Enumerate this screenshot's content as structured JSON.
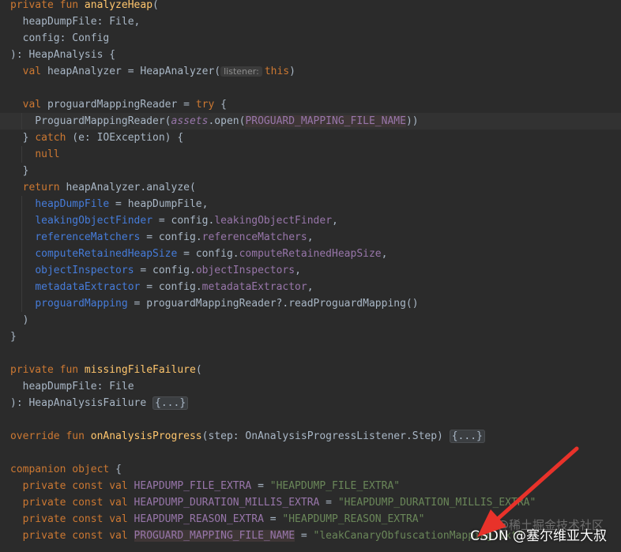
{
  "editor": {
    "lines": [
      [
        [
          "kw",
          "private fun "
        ],
        [
          "fn",
          "analyzeHeap"
        ],
        [
          "p",
          "("
        ]
      ],
      [
        [
          "p",
          "  heapDumpFile: File,"
        ]
      ],
      [
        [
          "p",
          "  config: Config"
        ]
      ],
      [
        [
          "p",
          "): HeapAnalysis {"
        ]
      ],
      [
        [
          "p",
          "  "
        ],
        [
          "kw",
          "val "
        ],
        [
          "p",
          "heapAnalyzer = HeapAnalyzer("
        ],
        [
          "hint",
          "listener:"
        ],
        [
          "kw",
          "this"
        ],
        [
          "p",
          ")"
        ]
      ],
      [],
      [
        [
          "p",
          "  "
        ],
        [
          "kw",
          "val "
        ],
        [
          "p",
          "proguardMappingReader = "
        ],
        [
          "kw",
          "try "
        ],
        [
          "p",
          "{"
        ]
      ],
      [
        [
          "p",
          "    ProguardMappingReader("
        ],
        [
          "prop-i",
          "assets"
        ],
        [
          "p",
          ".open("
        ],
        [
          "const",
          "PROGUARD_MAPPING_FILE_NAME"
        ],
        [
          "p",
          "))"
        ]
      ],
      [
        [
          "p",
          "  } "
        ],
        [
          "kw",
          "catch "
        ],
        [
          "p",
          "(e: IOException) {"
        ]
      ],
      [
        [
          "p",
          "    "
        ],
        [
          "kw",
          "null"
        ]
      ],
      [
        [
          "p",
          "  }"
        ]
      ],
      [
        [
          "p",
          "  "
        ],
        [
          "kw",
          "return "
        ],
        [
          "p",
          "heapAnalyzer.analyze("
        ]
      ],
      [
        [
          "p",
          "    "
        ],
        [
          "named",
          "heapDumpFile"
        ],
        [
          "p",
          " = heapDumpFile,"
        ]
      ],
      [
        [
          "p",
          "    "
        ],
        [
          "named",
          "leakingObjectFinder"
        ],
        [
          "p",
          " = config."
        ],
        [
          "prop",
          "leakingObjectFinder"
        ],
        [
          "p",
          ","
        ]
      ],
      [
        [
          "p",
          "    "
        ],
        [
          "named",
          "referenceMatchers"
        ],
        [
          "p",
          " = config."
        ],
        [
          "prop",
          "referenceMatchers"
        ],
        [
          "p",
          ","
        ]
      ],
      [
        [
          "p",
          "    "
        ],
        [
          "named",
          "computeRetainedHeapSize"
        ],
        [
          "p",
          " = config."
        ],
        [
          "prop",
          "computeRetainedHeapSize"
        ],
        [
          "p",
          ","
        ]
      ],
      [
        [
          "p",
          "    "
        ],
        [
          "named",
          "objectInspectors"
        ],
        [
          "p",
          " = config."
        ],
        [
          "prop",
          "objectInspectors"
        ],
        [
          "p",
          ","
        ]
      ],
      [
        [
          "p",
          "    "
        ],
        [
          "named",
          "metadataExtractor"
        ],
        [
          "p",
          " = config."
        ],
        [
          "prop",
          "metadataExtractor"
        ],
        [
          "p",
          ","
        ]
      ],
      [
        [
          "p",
          "    "
        ],
        [
          "named",
          "proguardMapping"
        ],
        [
          "p",
          " = proguardMappingReader?.readProguardMapping()"
        ]
      ],
      [
        [
          "p",
          "  )"
        ]
      ],
      [
        [
          "p",
          "}"
        ]
      ],
      [],
      [
        [
          "kw",
          "private fun "
        ],
        [
          "fn",
          "missingFileFailure"
        ],
        [
          "p",
          "("
        ]
      ],
      [
        [
          "p",
          "  heapDumpFile: File"
        ]
      ],
      [
        [
          "p",
          "): HeapAnalysisFailure "
        ],
        [
          "fold",
          "{...}"
        ]
      ],
      [],
      [
        [
          "kw",
          "override fun "
        ],
        [
          "fn",
          "onAnalysisProgress"
        ],
        [
          "p",
          "(step: OnAnalysisProgressListener.Step) "
        ],
        [
          "fold",
          "{...}"
        ]
      ],
      [],
      [
        [
          "kw",
          "companion object "
        ],
        [
          "p",
          "{"
        ]
      ],
      [
        [
          "p",
          "  "
        ],
        [
          "kw",
          "private const val "
        ],
        [
          "prop",
          "HEAPDUMP_FILE_EXTRA"
        ],
        [
          "p",
          " = "
        ],
        [
          "str",
          "\"HEAPDUMP_FILE_EXTRA\""
        ]
      ],
      [
        [
          "p",
          "  "
        ],
        [
          "kw",
          "private const val "
        ],
        [
          "prop",
          "HEAPDUMP_DURATION_MILLIS_EXTRA"
        ],
        [
          "p",
          " = "
        ],
        [
          "str",
          "\"HEAPDUMP_DURATION_MILLIS_EXTRA\""
        ]
      ],
      [
        [
          "p",
          "  "
        ],
        [
          "kw",
          "private const val "
        ],
        [
          "prop",
          "HEAPDUMP_REASON_EXTRA"
        ],
        [
          "p",
          " = "
        ],
        [
          "str",
          "\"HEAPDUMP_REASON_EXTRA\""
        ]
      ],
      [
        [
          "p",
          "  "
        ],
        [
          "kw",
          "private const val "
        ],
        [
          "const",
          "PROGUARD_MAPPING_FILE_NAME"
        ],
        [
          "p",
          " = "
        ],
        [
          "str",
          "\"leakCanaryObfuscationMapping.txt\""
        ]
      ]
    ],
    "current_line": 7
  },
  "watermark": {
    "faint": "@稀土掘金技术社区",
    "main": "CSDN @塞尔维亚大叔"
  },
  "colors": {
    "background": "#2b2b2b",
    "keyword": "#cc7832",
    "function": "#ffc66d",
    "property": "#9876aa",
    "named_argument": "#467cda",
    "string": "#6a8759",
    "text": "#a9b7c6",
    "arrow": "#e8322a"
  }
}
